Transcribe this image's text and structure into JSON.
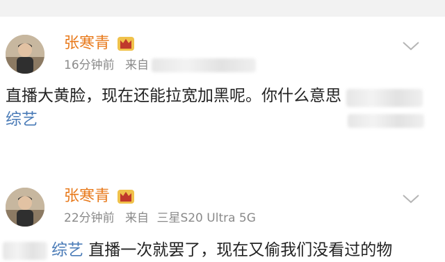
{
  "posts": [
    {
      "username": "张寒青",
      "time": "16分钟前",
      "source_label": "来自",
      "body": "直播大黄脸，现在还能拉宽加黑呢。你什么意思",
      "tag": "综艺"
    },
    {
      "username": "张寒青",
      "time": "22分钟前",
      "source_label": "来自",
      "device": "三星S20 Ultra 5G",
      "tag": "综艺",
      "body": " 直播一次就罢了，现在又偷我们没看过的物"
    }
  ],
  "icons": {
    "badge": "crown-badge-icon",
    "expand": "chevron-down-icon"
  },
  "colors": {
    "username": "#e87a1c",
    "meta": "#8a8a8a",
    "body": "#222222",
    "tag": "#4a7bb7",
    "top_bar": "#f2f2f2"
  }
}
